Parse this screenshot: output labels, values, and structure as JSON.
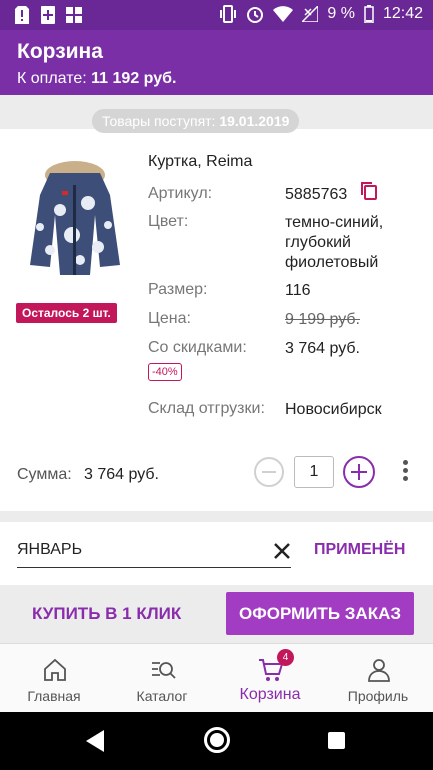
{
  "status_bar": {
    "battery": "9 %",
    "time": "12:42"
  },
  "header": {
    "title": "Корзина",
    "to_pay_label": "К оплате:",
    "to_pay_value": "11 192 руб."
  },
  "arrival": {
    "label": "Товары поступят:",
    "date": "19.01.2019"
  },
  "product": {
    "name": "Куртка, Reima",
    "stock_badge": "Осталось 2 шт.",
    "article_label": "Артикул:",
    "article_value": "5885763",
    "color_label": "Цвет:",
    "color_value_1": "темно-синий,",
    "color_value_2": "глубокий",
    "color_value_3": "фиолетовый",
    "size_label": "Размер:",
    "size_value": "116",
    "price_label": "Цена:",
    "price_value": "9 199 руб.",
    "discount_label": "Со скидками:",
    "discount_value": "3 764 руб.",
    "discount_badge": "-40%",
    "warehouse_label": "Склад отгрузки:",
    "warehouse_value": "Новосибирск"
  },
  "summary": {
    "label": "Сумма:",
    "value": "3 764 руб.",
    "quantity": "1"
  },
  "promo": {
    "code": "ЯНВАРЬ",
    "applied_label": "ПРИМЕНЁН"
  },
  "actions": {
    "one_click": "КУПИТЬ В 1 КЛИК",
    "checkout": "ОФОРМИТЬ ЗАКАЗ"
  },
  "nav": {
    "items": [
      {
        "label": "Главная",
        "icon": "home-icon"
      },
      {
        "label": "Каталог",
        "icon": "catalog-search-icon"
      },
      {
        "label": "Корзина",
        "icon": "cart-icon",
        "badge": "4"
      },
      {
        "label": "Профиль",
        "icon": "profile-icon"
      }
    ]
  },
  "colors": {
    "primary": "#7b2fa6",
    "accent": "#a23cc2",
    "badge": "#c2185b"
  }
}
